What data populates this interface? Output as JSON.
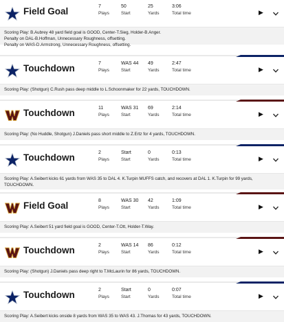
{
  "colors": {
    "cowboys": "#0b2265",
    "commanders": "#5a1414",
    "desc_bg": "#f2f2f2"
  },
  "labels": {
    "plays": "Plays",
    "start": "Start",
    "yards": "Yards",
    "total_time": "Total time"
  },
  "drives": [
    {
      "team": "cowboys",
      "result": "Field Goal",
      "plays": "7",
      "start": "50",
      "yards": "25",
      "time": "3:06",
      "lines": [
        "Scoring Play: B.Aubrey 48 yard field goal is GOOD, Center-T.Sieg, Holder-B.Anger.",
        "Penalty on DAL-B.Hoffman, Unnecessary Roughness, offsetting.",
        "Penalty on WAS-D.Armstrong, Unnecessary Roughness, offsetting."
      ]
    },
    {
      "team": "cowboys",
      "result": "Touchdown",
      "plays": "7",
      "start": "WAS 44",
      "yards": "49",
      "time": "2:47",
      "lines": [
        "Scoring Play: (Shotgun) C.Rush pass deep middle to L.Schoonmaker for 22 yards, TOUCHDOWN."
      ]
    },
    {
      "team": "commanders",
      "result": "Touchdown",
      "plays": "11",
      "start": "WAS 31",
      "yards": "69",
      "time": "2:14",
      "lines": [
        "Scoring Play: (No Huddle, Shotgun) J.Daniels pass short middle to Z.Ertz for 4 yards, TOUCHDOWN."
      ]
    },
    {
      "team": "cowboys",
      "result": "Touchdown",
      "plays": "2",
      "start": "Start",
      "yards": "0",
      "time": "0:13",
      "lines": [
        "Scoring Play: A.Seibert kicks 61 yards from WAS 35 to DAL 4. K.Turpin MUFFS catch, and recovers at DAL 1. K.Turpin for 99 yards,",
        "TOUCHDOWN."
      ]
    },
    {
      "team": "commanders",
      "result": "Field Goal",
      "plays": "8",
      "start": "WAS 30",
      "yards": "42",
      "time": "1:09",
      "lines": [
        "Scoring Play: A.Seibert 51 yard field goal is GOOD, Center-T.Ott, Holder-T.Way."
      ]
    },
    {
      "team": "commanders",
      "result": "Touchdown",
      "plays": "2",
      "start": "WAS 14",
      "yards": "86",
      "time": "0:12",
      "lines": [
        "Scoring Play: (Shotgun) J.Daniels pass deep right to T.McLaurin for 86 yards, TOUCHDOWN."
      ]
    },
    {
      "team": "cowboys",
      "result": "Touchdown",
      "plays": "2",
      "start": "Start",
      "yards": "0",
      "time": "0:07",
      "lines": [
        "Scoring Play: A.Seibert kicks onside 8 yards from WAS 35 to WAS 43. J.Thomas for 43 yards, TOUCHDOWN."
      ]
    }
  ]
}
